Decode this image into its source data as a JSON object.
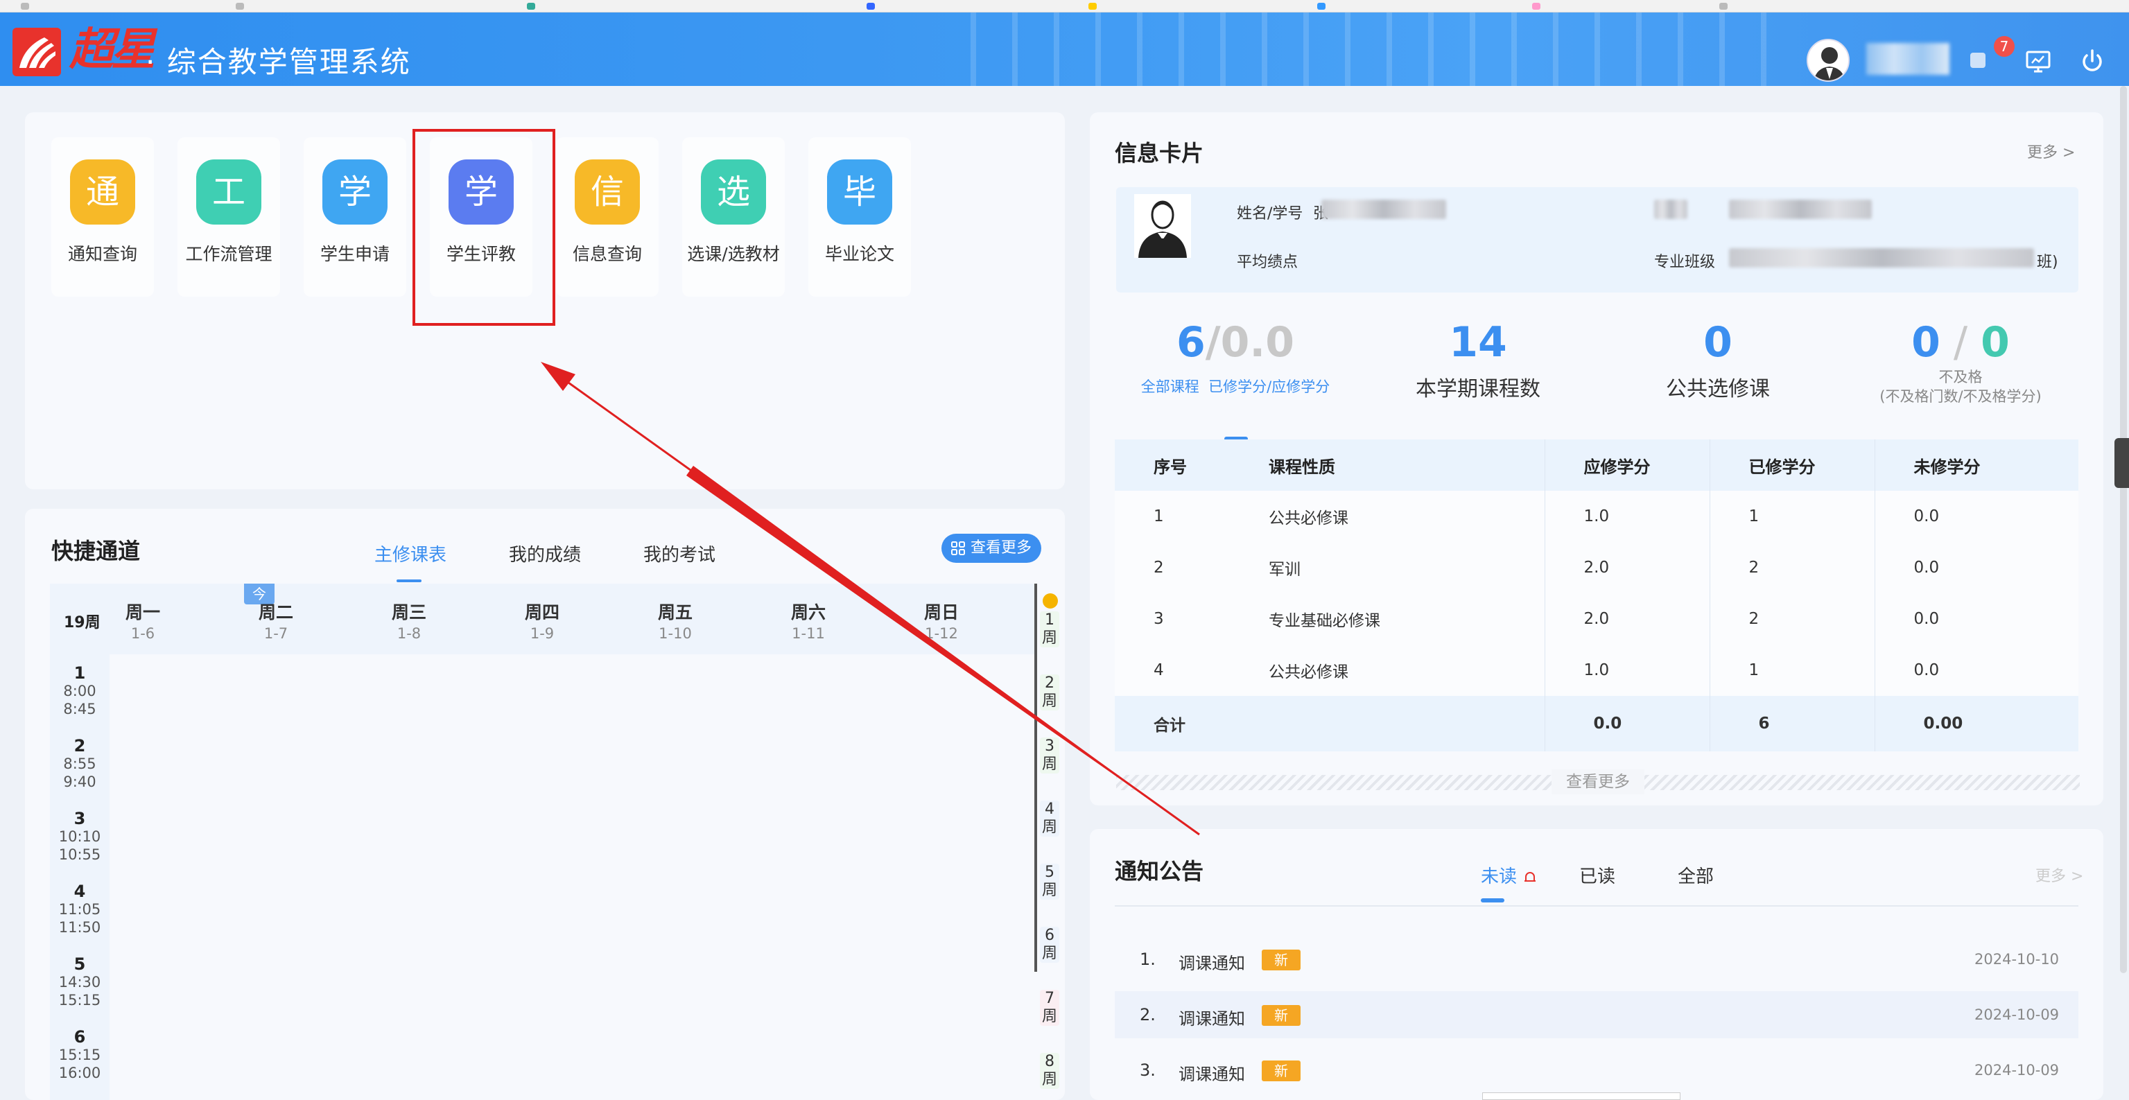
{
  "header": {
    "logo_text": "超星",
    "system_title": "· 综合教学管理系统",
    "notification_count": "7"
  },
  "apps": [
    {
      "label": "通知查询",
      "icon_char": "通",
      "color": "#f7b928"
    },
    {
      "label": "工作流管理",
      "icon_char": "工",
      "color": "#3fcfb3"
    },
    {
      "label": "学生申请",
      "icon_char": "学",
      "color": "#3fa6f2"
    },
    {
      "label": "学生评教",
      "icon_char": "学",
      "color": "#5b7cf0"
    },
    {
      "label": "信息查询",
      "icon_char": "信",
      "color": "#f7b928"
    },
    {
      "label": "选课/选教材",
      "icon_char": "选",
      "color": "#3fcfb3"
    },
    {
      "label": "毕业论文",
      "icon_char": "毕",
      "color": "#3fa6f2"
    }
  ],
  "quick": {
    "title": "快捷通道",
    "tabs": [
      "主修课表",
      "我的成绩",
      "我的考试"
    ],
    "more_label": "查看更多",
    "week_label": "19周",
    "today_label": "今",
    "days": [
      {
        "name": "周一",
        "date": "1-6"
      },
      {
        "name": "周二",
        "date": "1-7"
      },
      {
        "name": "周三",
        "date": "1-8"
      },
      {
        "name": "周四",
        "date": "1-9"
      },
      {
        "name": "周五",
        "date": "1-10"
      },
      {
        "name": "周六",
        "date": "1-11"
      },
      {
        "name": "周日",
        "date": "1-12"
      }
    ],
    "periods": [
      {
        "num": "1",
        "start": "8:00",
        "end": "8:45"
      },
      {
        "num": "2",
        "start": "8:55",
        "end": "9:40"
      },
      {
        "num": "3",
        "start": "10:10",
        "end": "10:55"
      },
      {
        "num": "4",
        "start": "11:05",
        "end": "11:50"
      },
      {
        "num": "5",
        "start": "14:30",
        "end": "15:15"
      },
      {
        "num": "6",
        "start": "15:15",
        "end": "16:00"
      }
    ],
    "weeks": [
      "1\n周",
      "2\n周",
      "3\n周",
      "4\n周",
      "5\n周",
      "6\n周",
      "7\n周",
      "8\n周"
    ]
  },
  "info": {
    "title": "信息卡片",
    "more": "更多 >",
    "name_label": "姓名/学号",
    "name_prefix": "张",
    "gpa_label": "平均绩点",
    "major_label": "专业班级",
    "major_suffix": "班)",
    "stats": {
      "credits_done": "6",
      "credits_sep": "/0.0",
      "credits_sub_all": "全部课程",
      "credits_sub": "已修学分/应修学分",
      "courses_num": "14",
      "courses_label": "本学期课程数",
      "electives_num": "0",
      "electives_label": "公共选修课",
      "fail_a": "0",
      "fail_sep": " / ",
      "fail_b": "0",
      "fail_label": "不及格",
      "fail_sub": "(不及格门数/不及格学分)"
    },
    "table": {
      "headers": [
        "序号",
        "课程性质",
        "应修学分",
        "已修学分",
        "未修学分"
      ],
      "rows": [
        [
          "1",
          "公共必修课",
          "1.0",
          "1",
          "0.0"
        ],
        [
          "2",
          "军训",
          "2.0",
          "2",
          "0.0"
        ],
        [
          "3",
          "专业基础必修课",
          "2.0",
          "2",
          "0.0"
        ],
        [
          "4",
          "公共必修课",
          "1.0",
          "1",
          "0.0"
        ]
      ],
      "total": [
        "合计",
        "",
        "0.0",
        "6",
        "0.00"
      ]
    },
    "view_more": "查看更多"
  },
  "notice": {
    "title": "通知公告",
    "tabs": [
      "未读",
      "已读",
      "全部"
    ],
    "more": "更多 >",
    "new_tag": "新",
    "items": [
      {
        "num": "1.",
        "text": "调课通知",
        "date": "2024-10-10"
      },
      {
        "num": "2.",
        "text": "调课通知",
        "date": "2024-10-09"
      },
      {
        "num": "3.",
        "text": "调课通知",
        "date": "2024-10-09"
      }
    ]
  }
}
